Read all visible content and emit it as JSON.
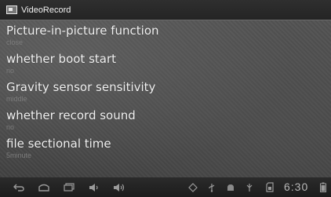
{
  "window": {
    "title": "VideoRecord",
    "icon": "video-record-app-icon"
  },
  "preferences": [
    {
      "title": "Picture-in-picture function",
      "summary": "close"
    },
    {
      "title": "whether boot start",
      "summary": "no"
    },
    {
      "title": "Gravity sensor sensitivity",
      "summary": "middle"
    },
    {
      "title": "whether record sound",
      "summary": "no"
    },
    {
      "title": "file sectional time",
      "summary": "5minute"
    }
  ],
  "navbar": {
    "buttons": [
      "back-icon",
      "home-icon",
      "recent-apps-icon",
      "volume-down-icon",
      "volume-up-icon"
    ],
    "status_icons": [
      "notification-diamond-icon",
      "usb-icon",
      "android-debug-icon",
      "signal-icon",
      "sd-card-icon",
      "battery-icon"
    ],
    "clock": "6:30"
  },
  "colors": {
    "title_text": "#f0f0f0",
    "summary_text": "#7c7c7c",
    "navbar_bg": "#1c1c1c"
  }
}
